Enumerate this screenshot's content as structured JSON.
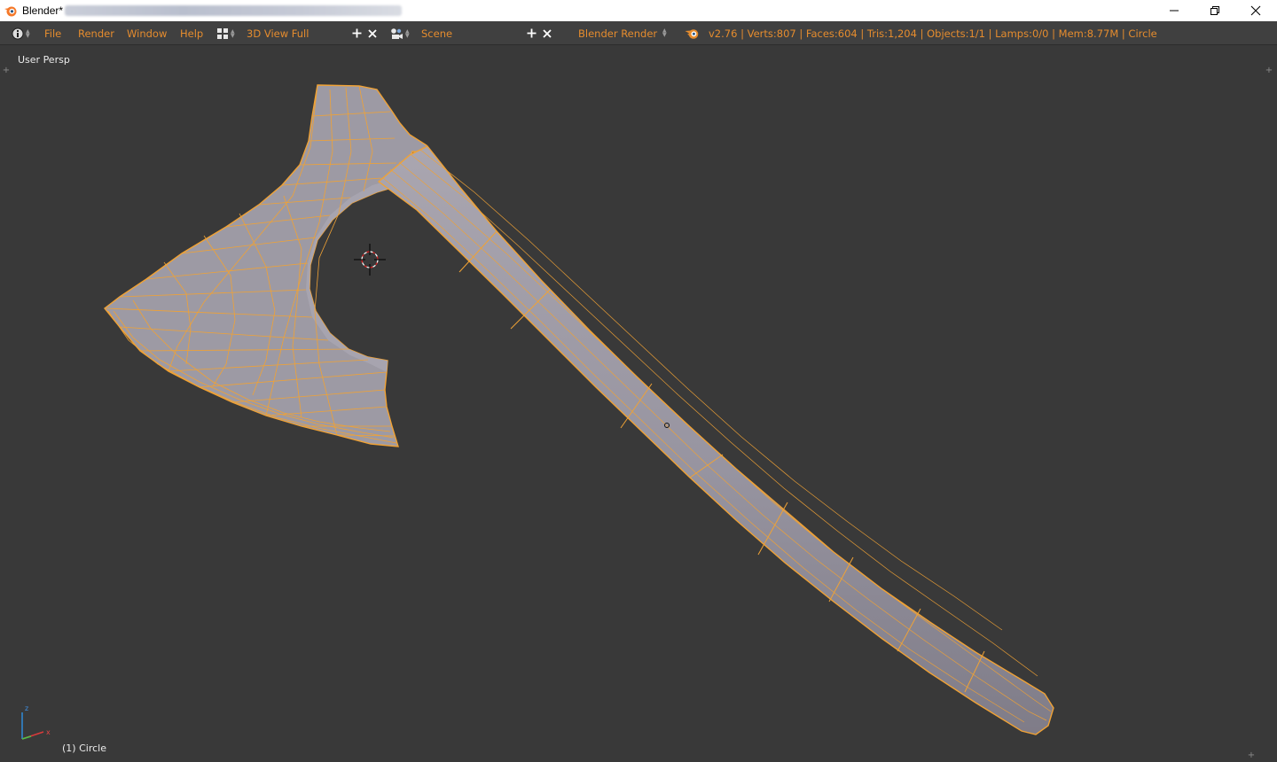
{
  "window": {
    "title": "Blender*",
    "controls": {
      "minimize_icon": "minimize-icon",
      "restore_icon": "restore-icon",
      "close_icon": "close-icon"
    }
  },
  "header": {
    "info_editor_icon": "info-icon",
    "menus": [
      "File",
      "Render",
      "Window",
      "Help"
    ],
    "layout_icon": "screen-layout-icon",
    "layout": "3D View Full",
    "scene_icon": "scene-icon",
    "scene": "Scene",
    "render_engine": "Blender Render",
    "blender_logo_icon": "blender-logo-icon",
    "stats": "v2.76 | Verts:807 | Faces:604 | Tris:1,204 | Objects:1/1 | Lamps:0/0 | Mem:8.77M | Circle",
    "accent": "#e58c2e"
  },
  "viewport": {
    "view_label": "User Persp",
    "object_label": "(1) Circle",
    "background": "#393939",
    "mesh_fill": "#9c99a3",
    "wire_color": "#f0a235",
    "cursor_icon": "3d-cursor-icon",
    "axis_widget": {
      "x": "x",
      "y": "y",
      "z": "z"
    }
  }
}
